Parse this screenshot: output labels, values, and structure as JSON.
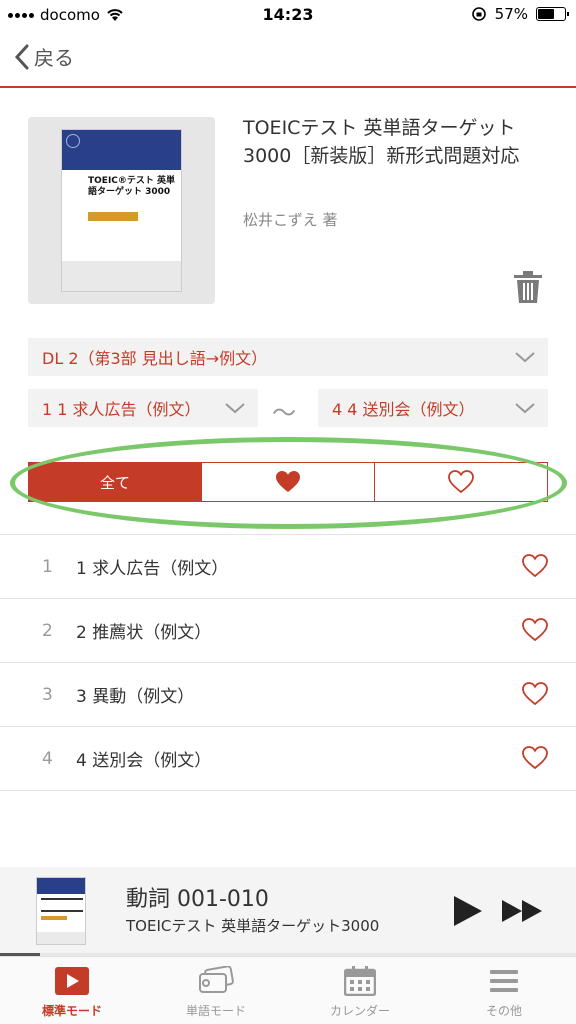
{
  "status_bar": {
    "carrier": "docomo",
    "time": "14:23",
    "battery": "57%",
    "battery_level": 0.57
  },
  "nav": {
    "back_label": "戻る"
  },
  "book": {
    "cover_title": "TOEIC®テスト 英単語ターゲット 3000",
    "title": "TOEICテスト 英単語ターゲット3000［新装版］新形式問題対応",
    "author": "松井こずえ 著"
  },
  "selectors": {
    "disc": "DL 2（第3部 見出し語→例文）",
    "range_start": "1 1 求人広告（例文）",
    "range_end": "4 4 送別会（例文）",
    "tilde": "〜"
  },
  "filter": {
    "all_label": "全て",
    "active": "all"
  },
  "items": [
    {
      "num": "1",
      "label": "1 求人広告（例文）"
    },
    {
      "num": "2",
      "label": "2 推薦状（例文）"
    },
    {
      "num": "3",
      "label": "3 異動（例文）"
    },
    {
      "num": "4",
      "label": "4 送別会（例文）"
    }
  ],
  "player": {
    "track": "動詞 001-010",
    "subtitle": "TOEICテスト 英単語ターゲット3000",
    "progress": 0.07
  },
  "tabs": [
    {
      "label": "標準モード",
      "icon": "play-screen-icon",
      "active": true
    },
    {
      "label": "単語モード",
      "icon": "word-cards-icon",
      "active": false
    },
    {
      "label": "カレンダー",
      "icon": "calendar-icon",
      "active": false
    },
    {
      "label": "その他",
      "icon": "menu-icon",
      "active": false
    }
  ],
  "colors": {
    "accent": "#c43c28",
    "highlight_ring": "#7ac86a"
  }
}
